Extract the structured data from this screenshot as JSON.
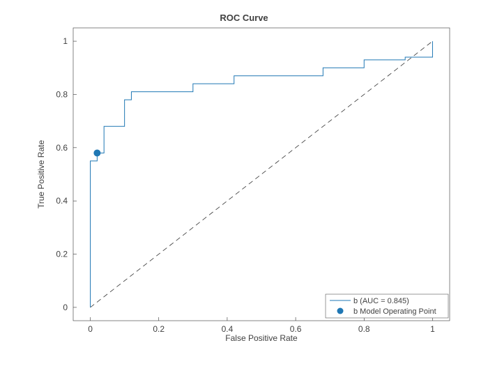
{
  "chart_data": {
    "type": "line",
    "title": "ROC Curve",
    "xlabel": "False Positive Rate",
    "ylabel": "True Positive Rate",
    "xlim": [
      -0.05,
      1.05
    ],
    "ylim": [
      -0.05,
      1.05
    ],
    "xticks": [
      0,
      0.2,
      0.4,
      0.6,
      0.8,
      1
    ],
    "yticks": [
      0,
      0.2,
      0.4,
      0.6,
      0.8,
      1
    ],
    "series": [
      {
        "name": "b (AUC = 0.845)",
        "style": "step-line",
        "color": "#1f77b4",
        "x": [
          0.0,
          0.0,
          0.0,
          0.02,
          0.02,
          0.04,
          0.04,
          0.1,
          0.1,
          0.12,
          0.12,
          0.3,
          0.3,
          0.42,
          0.42,
          0.68,
          0.68,
          0.8,
          0.8,
          0.92,
          0.92,
          1.0,
          1.0
        ],
        "y": [
          0.0,
          0.52,
          0.55,
          0.55,
          0.58,
          0.58,
          0.68,
          0.68,
          0.78,
          0.78,
          0.81,
          0.81,
          0.84,
          0.84,
          0.87,
          0.87,
          0.9,
          0.9,
          0.93,
          0.93,
          0.94,
          0.94,
          1.0
        ]
      },
      {
        "name": "b Model Operating Point",
        "style": "marker",
        "color": "#1f77b4",
        "x": [
          0.02
        ],
        "y": [
          0.58
        ]
      },
      {
        "name": "Reference",
        "style": "dashed",
        "color": "#333333",
        "x": [
          0.0,
          1.0
        ],
        "y": [
          0.0,
          1.0
        ]
      }
    ],
    "legend": {
      "entries": [
        "b (AUC = 0.845)",
        "b Model Operating Point"
      ]
    }
  }
}
